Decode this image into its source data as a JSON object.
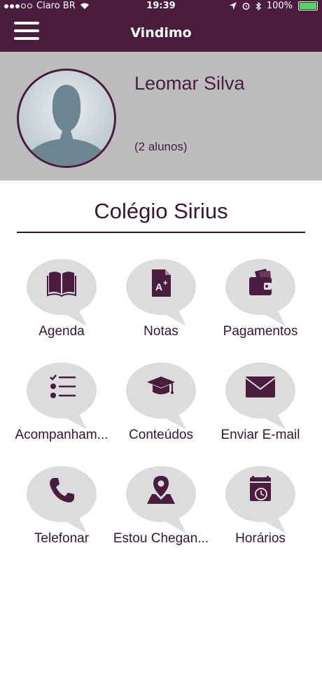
{
  "status_bar": {
    "carrier": "Claro BR",
    "time": "19:39",
    "battery": "100%"
  },
  "nav": {
    "title": "Vindimo",
    "menu_icon": "hamburger-icon"
  },
  "profile": {
    "name": "Leomar Silva",
    "students": "(2 alunos)",
    "avatar_icon": "user-silhouette-icon"
  },
  "school": {
    "name": "Colégio Sirius"
  },
  "tiles": [
    {
      "label": "Agenda",
      "icon": "book-icon"
    },
    {
      "label": "Notas",
      "icon": "grade-document-icon"
    },
    {
      "label": "Pagamentos",
      "icon": "wallet-icon"
    },
    {
      "label": "Acompanham...",
      "icon": "checklist-icon"
    },
    {
      "label": "Conteúdos",
      "icon": "graduation-cap-icon"
    },
    {
      "label": "Enviar E-mail",
      "icon": "envelope-icon"
    },
    {
      "label": "Telefonar",
      "icon": "phone-icon"
    },
    {
      "label": "Estou Chegan...",
      "icon": "map-pin-icon"
    },
    {
      "label": "Horários",
      "icon": "calendar-clock-icon"
    }
  ],
  "colors": {
    "brand": "#4a1d3f",
    "profile_bg": "#bdbdbd",
    "bubble": "#dcdcdc"
  }
}
